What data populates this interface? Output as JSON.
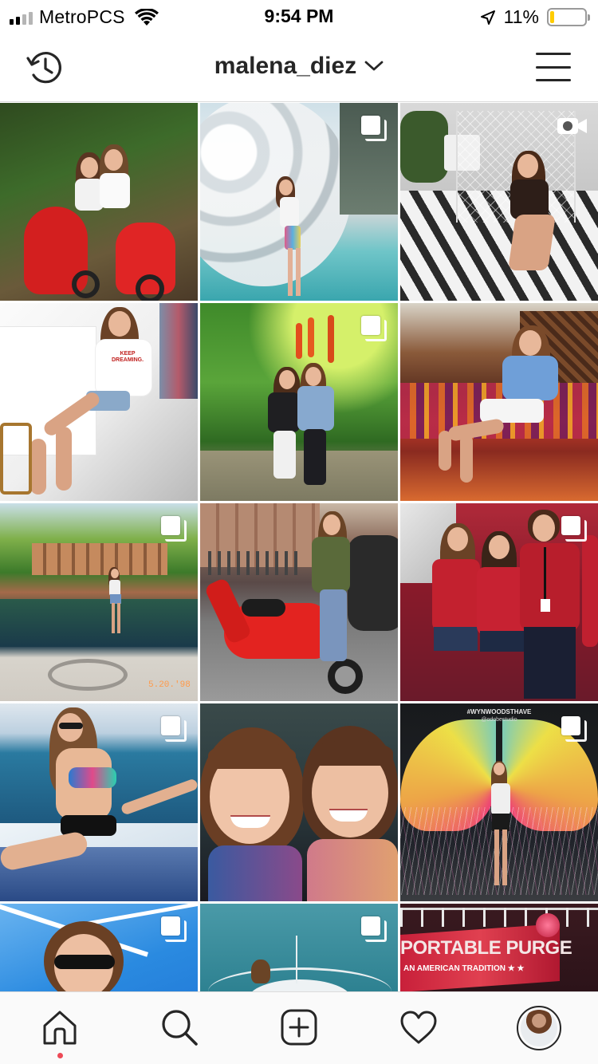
{
  "status_bar": {
    "carrier": "MetroPCS",
    "time": "9:54 PM",
    "battery_percent": "11%",
    "battery_level": 0.11,
    "signal_bars": 2,
    "icons": [
      "signal-icon",
      "wifi-icon",
      "location-arrow-icon",
      "battery-icon"
    ]
  },
  "header": {
    "username": "malena_diez",
    "left_icon": "history-icon",
    "dropdown_icon": "chevron-down-icon",
    "right_icon": "hamburger-menu-icon"
  },
  "grid": {
    "posts": [
      {
        "id": "p1",
        "badge": "none",
        "scene": "two girls on red scooters"
      },
      {
        "id": "p2",
        "badge": "multiple",
        "scene": "girl by bubble dome fountain"
      },
      {
        "id": "p3",
        "badge": "video",
        "scene": "girl in hammock chair"
      },
      {
        "id": "p4",
        "badge": "none",
        "scene": "girl seated in white shirt"
      },
      {
        "id": "p5",
        "badge": "multiple",
        "scene": "two girls in garden"
      },
      {
        "id": "p6",
        "badge": "none",
        "scene": "girl on woven bench"
      },
      {
        "id": "p7",
        "badge": "multiple",
        "scene": "girl at palace garden pool"
      },
      {
        "id": "p8",
        "badge": "none",
        "scene": "girl with red scooter on street"
      },
      {
        "id": "p9",
        "badge": "multiple",
        "scene": "group in red shirts"
      },
      {
        "id": "p10",
        "badge": "multiple",
        "scene": "girl on boat at sea"
      },
      {
        "id": "p11",
        "badge": "none",
        "scene": "two young girls smiling"
      },
      {
        "id": "p12",
        "badge": "multiple",
        "scene": "girl before angel wings mural"
      },
      {
        "id": "p13",
        "badge": "multiple",
        "scene": "girl with sunglasses on boat"
      },
      {
        "id": "p14",
        "badge": "multiple",
        "scene": "boat bow on water"
      },
      {
        "id": "p15",
        "badge": "none",
        "scene": "sign at night"
      }
    ],
    "text_in_photos": {
      "p12_mural_top": "#WYNWOODSTHAVE",
      "p12_mural_sub": "@odobestudio",
      "p15_sign": "PORTABLE PURGE",
      "p15_sub": "AN AMERICAN TRADITION ★ ★",
      "p7_date": "5.20.'98",
      "p4_shirt": "KEEP DREAMING."
    }
  },
  "tab_bar": {
    "tabs": [
      {
        "name": "home",
        "icon": "home-icon",
        "active": true
      },
      {
        "name": "search",
        "icon": "search-icon",
        "active": false
      },
      {
        "name": "new-post",
        "icon": "add-post-icon",
        "active": false
      },
      {
        "name": "activity",
        "icon": "heart-icon",
        "active": false
      },
      {
        "name": "profile",
        "icon": "profile-avatar",
        "active": false
      }
    ],
    "notification_dot_color": "#ed4956"
  }
}
